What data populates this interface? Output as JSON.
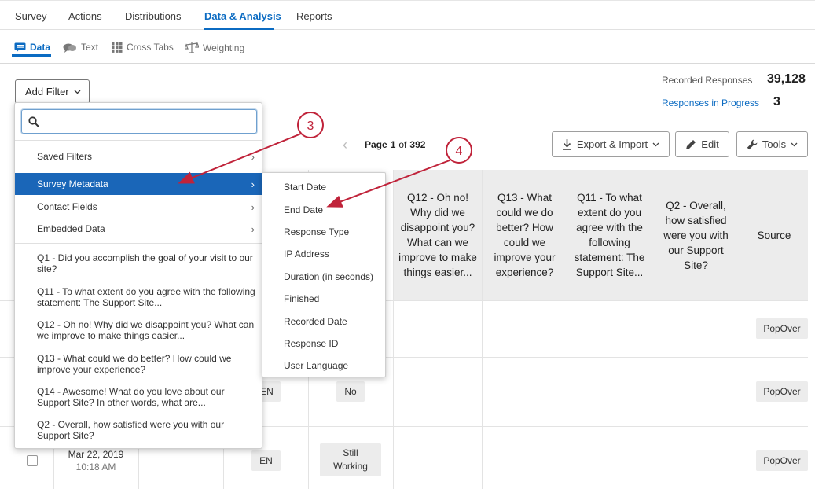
{
  "topnav": {
    "tabs": [
      "Survey",
      "Actions",
      "Distributions",
      "Data & Analysis",
      "Reports"
    ],
    "active": "Data & Analysis"
  },
  "subnav": {
    "items": [
      "Data",
      "Text",
      "Cross Tabs",
      "Weighting"
    ],
    "active": "Data"
  },
  "filter": {
    "add_filter_label": "Add Filter"
  },
  "stats": {
    "recorded_label": "Recorded Responses",
    "recorded_value": "39,128",
    "in_progress_label": "Responses in Progress",
    "in_progress_value": "3"
  },
  "pager": {
    "page_word": "Page",
    "current": "1",
    "of_word": "of",
    "total": "392"
  },
  "toolbar": {
    "export_label": "Export & Import",
    "edit_label": "Edit",
    "tools_label": "Tools"
  },
  "table": {
    "headers": {
      "q12": "Q12 - Oh no! Why did we disappoint you? What can we improve to make things easier...",
      "q13": "Q13 - What could we do better? How could we improve your experience?",
      "q11": "Q11 - To what extent do you agree with the following statement: The Support Site...",
      "q2": "Q2 - Overall, how satisfied were you with our Support Site?",
      "source": "Source"
    },
    "rows": [
      {
        "source": "PopOver"
      },
      {
        "language": "EN",
        "finished": "No",
        "source": "PopOver"
      },
      {
        "date": "Mar 22, 2019",
        "time": "10:18 AM",
        "language": "EN",
        "finished": "Still Working",
        "source": "PopOver"
      }
    ]
  },
  "dropdown": {
    "search_value": "",
    "categories": [
      {
        "label": "Saved Filters"
      },
      {
        "label": "Survey Metadata"
      },
      {
        "label": "Contact Fields"
      },
      {
        "label": "Embedded Data"
      }
    ],
    "highlighted": "Survey Metadata",
    "questions": [
      "Q1 - Did you accomplish the goal of your visit to our site?",
      "Q11 - To what extent do you agree with the following statement: The Support Site...",
      "Q12 - Oh no! Why did we disappoint you? What can we improve to make things easier...",
      "Q13 - What could we do better? How could we improve your experience?",
      "Q14 - Awesome! What do you love about our Support Site? In other words, what are...",
      "Q2 - Overall, how satisfied were you with our Support Site?"
    ]
  },
  "submenu": {
    "items": [
      "Start Date",
      "End Date",
      "Response Type",
      "IP Address",
      "Duration (in seconds)",
      "Finished",
      "Recorded Date",
      "Response ID",
      "User Language"
    ]
  },
  "annotations": {
    "step3": "3",
    "step4": "4",
    "color": "#c0233a"
  },
  "colors": {
    "accent": "#0b6bc2",
    "highlight": "#1a66b8",
    "header_bg": "#ececec"
  }
}
